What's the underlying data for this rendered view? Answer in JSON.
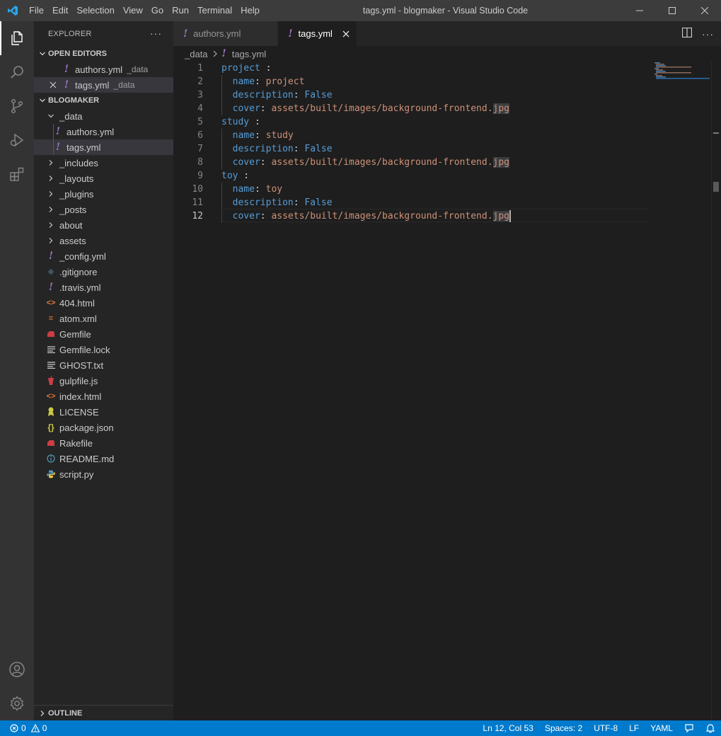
{
  "titlebar": {
    "menu": [
      "File",
      "Edit",
      "Selection",
      "View",
      "Go",
      "Run",
      "Terminal",
      "Help"
    ],
    "title": "tags.yml - blogmaker - Visual Studio Code"
  },
  "sidebar": {
    "title": "EXPLORER",
    "open_editors": {
      "label": "OPEN EDITORS",
      "items": [
        {
          "name": "authors.yml",
          "desc": "_data"
        },
        {
          "name": "tags.yml",
          "desc": "_data"
        }
      ]
    },
    "project": {
      "label": "BLOGMAKER",
      "tree": [
        {
          "name": "_data",
          "kind": "folder-open"
        },
        {
          "name": "authors.yml",
          "kind": "yml"
        },
        {
          "name": "tags.yml",
          "kind": "yml"
        },
        {
          "name": "_includes",
          "kind": "folder"
        },
        {
          "name": "_layouts",
          "kind": "folder"
        },
        {
          "name": "_plugins",
          "kind": "folder"
        },
        {
          "name": "_posts",
          "kind": "folder"
        },
        {
          "name": "about",
          "kind": "folder"
        },
        {
          "name": "assets",
          "kind": "folder"
        },
        {
          "name": "_config.yml",
          "kind": "yml"
        },
        {
          "name": ".gitignore",
          "kind": "git"
        },
        {
          "name": ".travis.yml",
          "kind": "yml"
        },
        {
          "name": "404.html",
          "kind": "html"
        },
        {
          "name": "atom.xml",
          "kind": "rss"
        },
        {
          "name": "Gemfile",
          "kind": "ruby"
        },
        {
          "name": "Gemfile.lock",
          "kind": "text"
        },
        {
          "name": "GHOST.txt",
          "kind": "text"
        },
        {
          "name": "gulpfile.js",
          "kind": "gulp"
        },
        {
          "name": "index.html",
          "kind": "html"
        },
        {
          "name": "LICENSE",
          "kind": "license"
        },
        {
          "name": "package.json",
          "kind": "json"
        },
        {
          "name": "Rakefile",
          "kind": "ruby"
        },
        {
          "name": "README.md",
          "kind": "info"
        },
        {
          "name": "script.py",
          "kind": "python"
        }
      ]
    },
    "outline_label": "OUTLINE"
  },
  "tabs": [
    {
      "label": "authors.yml",
      "active": false
    },
    {
      "label": "tags.yml",
      "active": true
    }
  ],
  "breadcrumb": {
    "folder": "_data",
    "file": "tags.yml"
  },
  "editor": {
    "current_line": 12,
    "lines": [
      {
        "n": 1,
        "indent": 0,
        "key": "project",
        "sep": " :",
        "value": ""
      },
      {
        "n": 2,
        "indent": 1,
        "key": "name",
        "sep": ": ",
        "value": "project"
      },
      {
        "n": 3,
        "indent": 1,
        "key": "description",
        "sep": ": ",
        "value": "False",
        "bool": true
      },
      {
        "n": 4,
        "indent": 1,
        "key": "cover",
        "sep": ": ",
        "value": "assets/built/images/background-frontend.",
        "ext": "jpg"
      },
      {
        "n": 5,
        "indent": 0,
        "key": "study",
        "sep": " :",
        "value": ""
      },
      {
        "n": 6,
        "indent": 1,
        "key": "name",
        "sep": ": ",
        "value": "study"
      },
      {
        "n": 7,
        "indent": 1,
        "key": "description",
        "sep": ": ",
        "value": "False",
        "bool": true
      },
      {
        "n": 8,
        "indent": 1,
        "key": "cover",
        "sep": ": ",
        "value": "assets/built/images/background-frontend.",
        "ext": "jpg"
      },
      {
        "n": 9,
        "indent": 0,
        "key": "toy",
        "sep": " :",
        "value": ""
      },
      {
        "n": 10,
        "indent": 1,
        "key": "name",
        "sep": ": ",
        "value": "toy"
      },
      {
        "n": 11,
        "indent": 1,
        "key": "description",
        "sep": ": ",
        "value": "False",
        "bool": true
      },
      {
        "n": 12,
        "indent": 1,
        "key": "cover",
        "sep": ": ",
        "value": "assets/built/images/background-frontend.",
        "ext": "jpg"
      }
    ]
  },
  "statusbar": {
    "errors": "0",
    "warnings": "0",
    "position": "Ln 12, Col 53",
    "spaces": "Spaces: 2",
    "encoding": "UTF-8",
    "eol": "LF",
    "language": "YAML"
  },
  "colors": {
    "accent": "#007acc",
    "yaml_key": "#569cd6",
    "yaml_string": "#ce9178",
    "yml_icon": "#a074c4"
  }
}
